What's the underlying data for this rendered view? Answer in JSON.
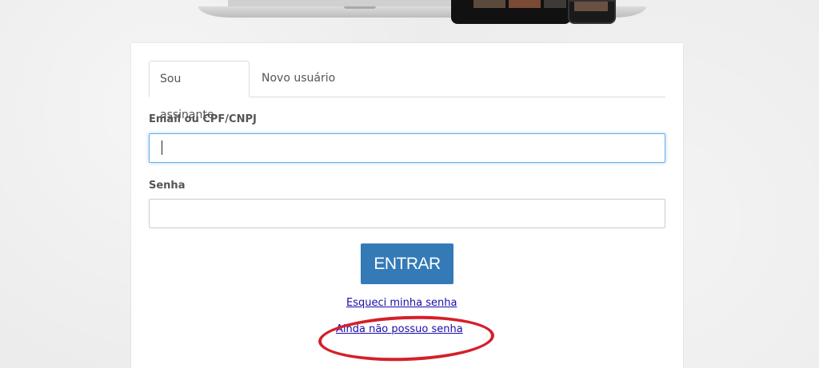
{
  "tabs": [
    {
      "label": "Sou assinante",
      "active": true
    },
    {
      "label": "Novo usuário",
      "active": false
    }
  ],
  "form": {
    "email_label": "Email ou CPF/CNPJ",
    "email_value": "",
    "password_label": "Senha",
    "password_value": ""
  },
  "actions": {
    "submit_label": "ENTRAR",
    "forgot_link": "Esqueci minha senha",
    "no_password_link": "Ainda não possuo senha"
  },
  "colors": {
    "primary_button": "#337ab7",
    "link": "#1a0dab",
    "highlight_annotation": "#d4202a"
  }
}
